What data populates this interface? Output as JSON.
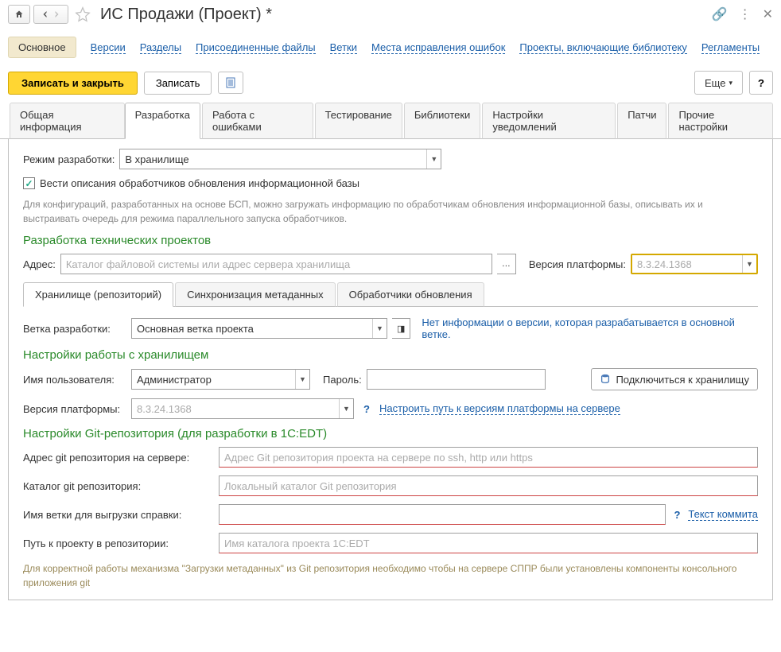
{
  "title": "ИС Продажи (Проект) *",
  "nav": {
    "active": "Основное",
    "links": [
      "Версии",
      "Разделы",
      "Присоединенные файлы",
      "Ветки",
      "Места исправления ошибок",
      "Проекты, включающие библиотеку",
      "Регламенты"
    ]
  },
  "toolbar": {
    "save_close": "Записать и закрыть",
    "save": "Записать",
    "more": "Еще",
    "help": "?"
  },
  "tabs": [
    "Общая информация",
    "Разработка",
    "Работа с ошибками",
    "Тестирование",
    "Библиотеки",
    "Настройки уведомлений",
    "Патчи",
    "Прочие настройки"
  ],
  "active_tab": "Разработка",
  "dev": {
    "mode_label": "Режим разработки:",
    "mode_value": "В хранилище",
    "checkbox_label": "Вести описания обработчиков обновления информационной базы",
    "hint": "Для конфигураций, разработанных на основе БСП, можно загружать информацию по обработчикам обновления информационной базы, описывать их и выстраивать очередь для режима параллельного запуска обработчиков.",
    "section1": "Разработка технических проектов",
    "address_label": "Адрес:",
    "address_placeholder": "Каталог файловой системы или адрес сервера хранилища",
    "platform_version_label": "Версия платформы:",
    "platform_version_placeholder": "8.3.24.1368",
    "subtabs": [
      "Хранилище (репозиторий)",
      "Синхронизация метаданных",
      "Обработчики обновления"
    ],
    "branch_label": "Ветка разработки:",
    "branch_value": "Основная ветка проекта",
    "branch_info": "Нет информации о версии, которая разрабатывается в основной ветке.",
    "section2": "Настройки работы с хранилищем",
    "user_label": "Имя пользователя:",
    "user_value": "Администратор",
    "password_label": "Пароль:",
    "connect_label": "Подключиться к хранилищу",
    "pv2_label": "Версия платформы:",
    "pv2_placeholder": "8.3.24.1368",
    "pv2_link": "Настроить путь к версиям платформы на сервере",
    "section3": "Настройки Git-репозитория (для разработки в 1С:EDT)",
    "git_addr_label": "Адрес git репозитория на сервере:",
    "git_addr_placeholder": "Адрес Git репозитория проекта на сервере по ssh, http или https",
    "git_catalog_label": "Каталог git репозитория:",
    "git_catalog_placeholder": "Локальный каталог Git репозитория",
    "git_branch_label": "Имя ветки для выгрузки справки:",
    "commit_text_link": "Текст коммита",
    "project_path_label": "Путь к проекту в репозитории:",
    "project_path_placeholder": "Имя каталога проекта 1С:EDT",
    "git_hint": "Для корректной работы механизма \"Загрузки метаданных\" из Git репозитория необходимо чтобы на сервере СППР были установлены компоненты консольного приложения git"
  }
}
